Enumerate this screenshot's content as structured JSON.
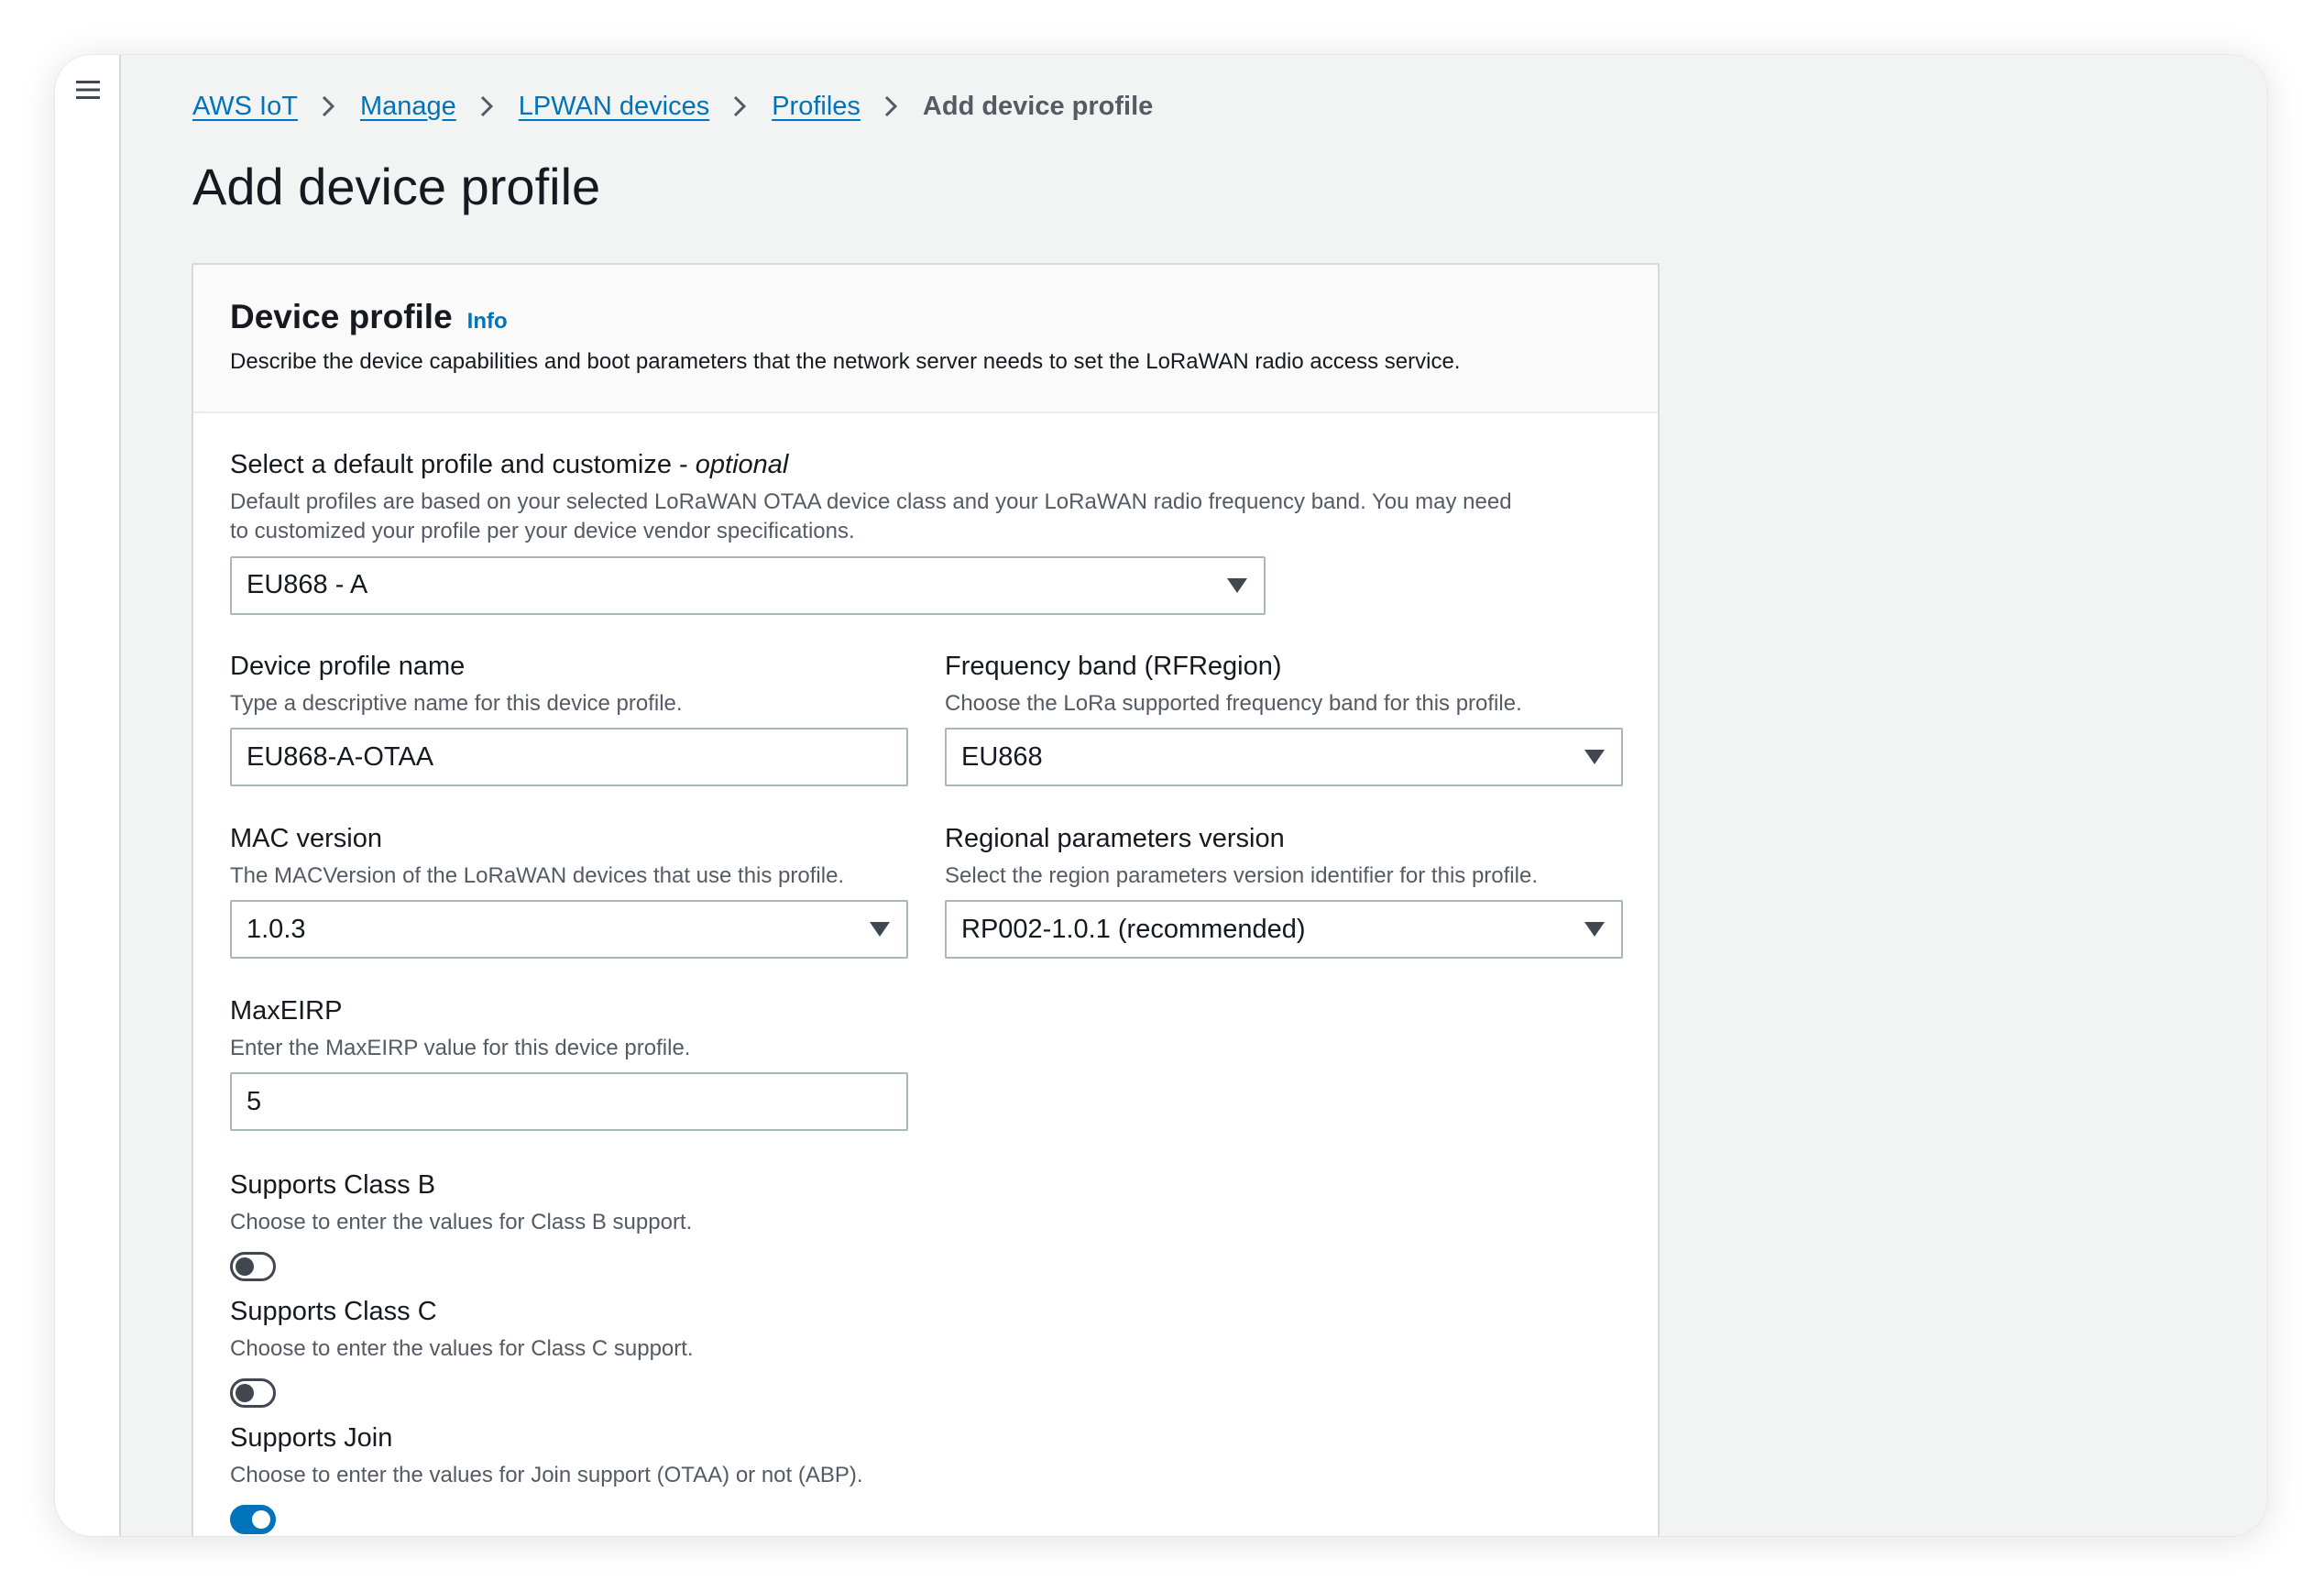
{
  "breadcrumb": {
    "items": [
      "AWS IoT",
      "Manage",
      "LPWAN devices",
      "Profiles"
    ],
    "current": "Add device profile"
  },
  "page": {
    "title": "Add device profile"
  },
  "panel": {
    "title": "Device profile",
    "info": "Info",
    "description": "Describe the device capabilities and boot parameters that the network server needs to set the LoRaWAN radio access service."
  },
  "default_profile": {
    "label": "Select a default profile and customize - ",
    "label_optional": "optional",
    "description": "Default profiles are based on your selected LoRaWAN OTAA device class and your LoRaWAN radio frequency band. You may need to customized your profile per your device vendor specifications.",
    "value": "EU868 - A"
  },
  "profile_name": {
    "label": "Device profile name",
    "description": "Type a descriptive name for this device profile.",
    "value": "EU868-A-OTAA"
  },
  "frequency_band": {
    "label": "Frequency band (RFRegion)",
    "description": "Choose the LoRa supported frequency band for this profile.",
    "value": "EU868"
  },
  "mac_version": {
    "label": "MAC version",
    "description": "The MACVersion of the LoRaWAN devices that use this profile.",
    "value": "1.0.3"
  },
  "regional_params": {
    "label": "Regional parameters version",
    "description": "Select the region parameters version identifier for this profile.",
    "value": "RP002-1.0.1 (recommended)"
  },
  "max_eirp": {
    "label": "MaxEIRP",
    "description": "Enter the MaxEIRP value for this device profile.",
    "value": "5"
  },
  "class_b": {
    "label": "Supports Class B",
    "description": "Choose to enter the values for Class B support.",
    "enabled": false
  },
  "class_c": {
    "label": "Supports Class C",
    "description": "Choose to enter the values for Class C support.",
    "enabled": false
  },
  "join": {
    "label": "Supports Join",
    "description": "Choose to enter the values for Join support (OTAA) or not (ABP).",
    "enabled": true
  },
  "colors": {
    "link": "#0073bb",
    "toggle_on": "#0073bb",
    "toggle_off": "#414750"
  },
  "icons": {
    "menu": "hamburger-menu-icon",
    "separator": "chevron-right-icon",
    "dropdown": "caret-down-icon"
  }
}
